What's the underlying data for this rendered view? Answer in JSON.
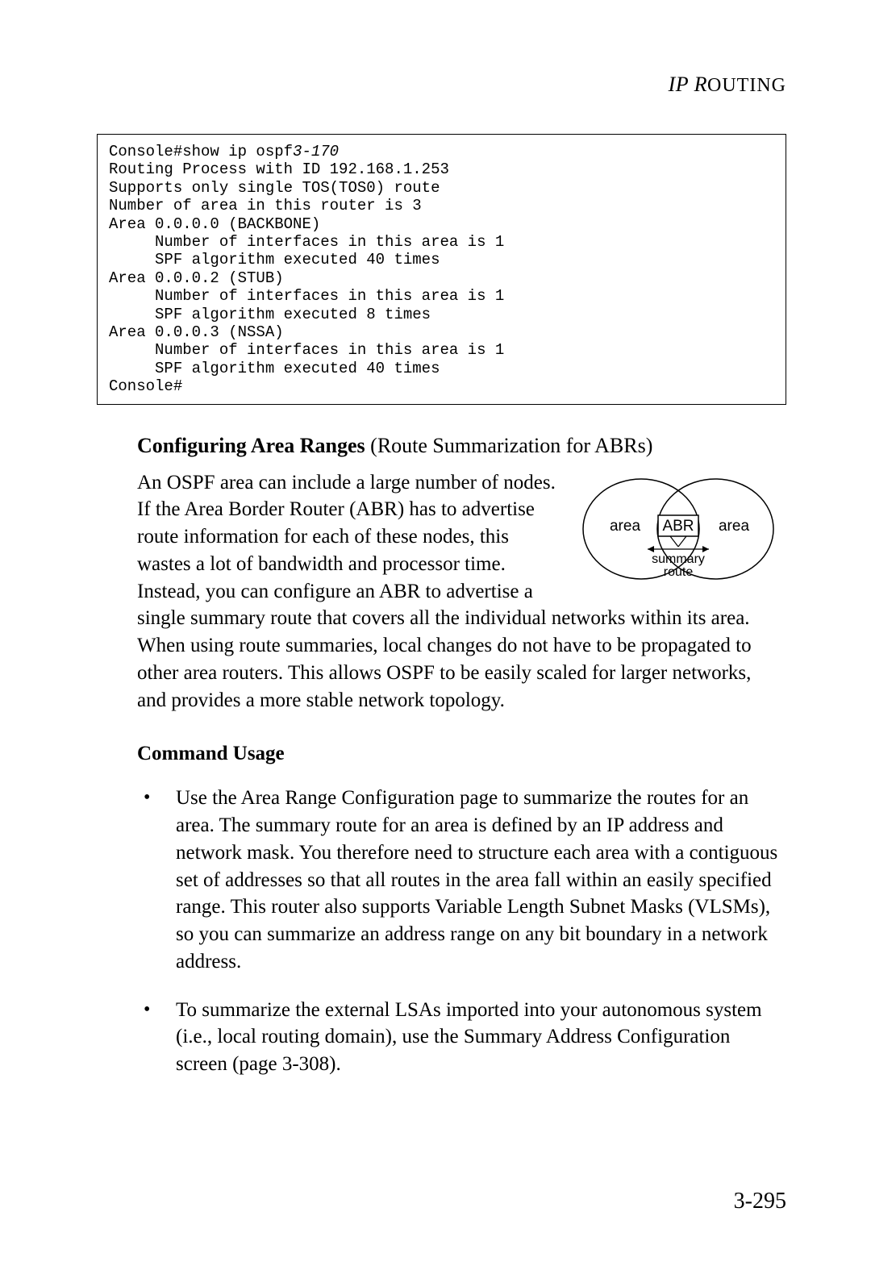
{
  "header": {
    "part1": "IP R",
    "part2": "OUTING"
  },
  "console": {
    "line1a": "Console#show ip ospf",
    "line1b": "3-170",
    "line2": "Routing Process with ID 192.168.1.253",
    "line3": "Supports only single TOS(TOS0) route",
    "line4": "Number of area in this router is 3",
    "line5": "Area 0.0.0.0 (BACKBONE)",
    "line6": "     Number of interfaces in this area is 1",
    "line7": "     SPF algorithm executed 40 times",
    "line8": "Area 0.0.0.2 (STUB)",
    "line9": "     Number of interfaces in this area is 1",
    "line10": "     SPF algorithm executed 8 times",
    "line11": "Area 0.0.0.3 (NSSA)",
    "line12": "     Number of interfaces in this area is 1",
    "line13": "     SPF algorithm executed 40 times",
    "line14": "Console#"
  },
  "section": {
    "title_bold": "Configuring Area Ranges",
    "title_rest": " (Route Summarization for ABRs)",
    "para": "An OSPF area can include a large number of nodes. If the Area Border Router (ABR) has to advertise route information for each of these nodes, this wastes a lot of bandwidth and processor time. Instead, you can configure an ABR to advertise a single summary route that covers all the individual networks within its area. When using route summaries, local changes do not have to be propagated to other area routers. This allows OSPF to be easily scaled for larger networks, and provides a more stable network topology."
  },
  "command_usage": {
    "heading": "Command Usage",
    "bullets": [
      "Use the Area Range Configuration page to summarize the routes for an area. The summary route for an area is defined by an IP address and network mask. You therefore need to structure each area with a contiguous set of addresses so that all routes in the area fall within an easily specified range. This router also supports Variable Length Subnet Masks (VLSMs), so you can summarize an address range on any bit boundary in a network address.",
      "To summarize the external LSAs imported into your autonomous system (i.e., local routing domain), use the Summary Address Configuration screen (page 3-308)."
    ]
  },
  "figure": {
    "area_left": "area",
    "area_right": "area",
    "abr": "ABR",
    "summary": "summary",
    "route": "route"
  },
  "page_number": "3-295"
}
